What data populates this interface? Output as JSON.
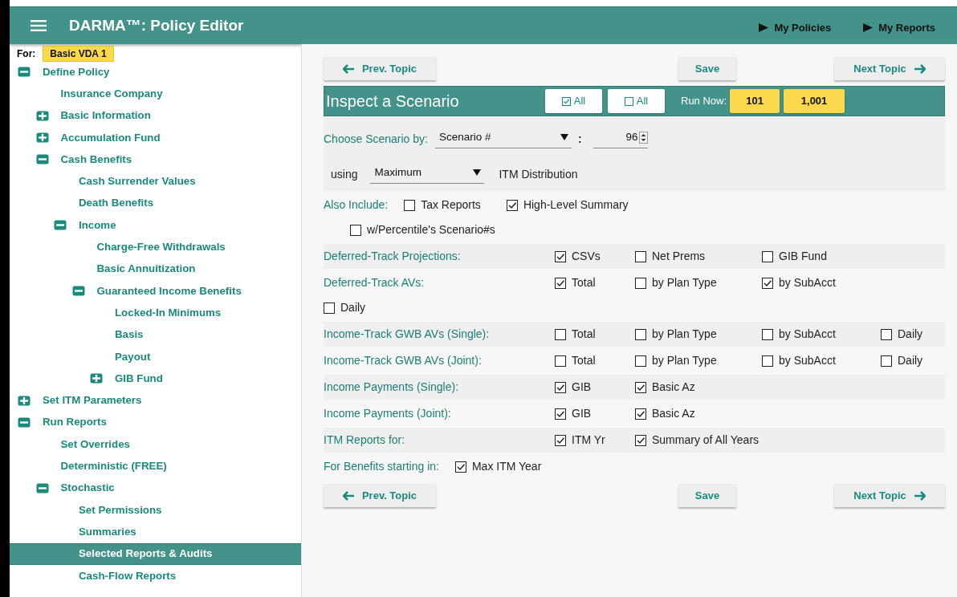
{
  "header": {
    "title": "DARMA™: Policy Editor",
    "links": [
      {
        "label": "My Policies"
      },
      {
        "label": "My Reports"
      }
    ]
  },
  "sidebar": {
    "for_label": "For:",
    "policy": "Basic VDA 1",
    "items": [
      {
        "label": "Define Policy",
        "expanded": true,
        "selected": false,
        "children": [
          {
            "label": "Insurance Company",
            "selected": false
          },
          {
            "label": "Basic Information",
            "expanded": false,
            "selected": false
          },
          {
            "label": "Accumulation Fund",
            "expanded": false,
            "selected": false
          },
          {
            "label": "Cash Benefits",
            "expanded": true,
            "selected": false,
            "children": [
              {
                "label": "Cash Surrender Values",
                "selected": false
              },
              {
                "label": "Death Benefits",
                "selected": false
              },
              {
                "label": "Income",
                "expanded": true,
                "selected": false,
                "children": [
                  {
                    "label": "Charge-Free Withdrawals",
                    "selected": false
                  },
                  {
                    "label": "Basic Annuitization",
                    "selected": false
                  },
                  {
                    "label": "Guaranteed Income Benefits",
                    "expanded": true,
                    "selected": false,
                    "children": [
                      {
                        "label": "Locked-In Minimums",
                        "selected": false
                      },
                      {
                        "label": "Basis",
                        "selected": false
                      },
                      {
                        "label": "Payout",
                        "selected": false
                      },
                      {
                        "label": "GIB Fund",
                        "expanded": false,
                        "selected": false
                      }
                    ]
                  }
                ]
              }
            ]
          }
        ]
      },
      {
        "label": "Set ITM Parameters",
        "expanded": false,
        "selected": false
      },
      {
        "label": "Run Reports",
        "expanded": true,
        "selected": false,
        "children": [
          {
            "label": "Set Overrides",
            "selected": false
          },
          {
            "label": "Deterministic (FREE)",
            "selected": false
          },
          {
            "label": "Stochastic",
            "expanded": true,
            "selected": false,
            "children": [
              {
                "label": "Set Permissions",
                "selected": false
              },
              {
                "label": "Summaries",
                "selected": false
              },
              {
                "label": "Selected Reports & Audits",
                "selected": true
              },
              {
                "label": "Cash-Flow Reports",
                "selected": false
              }
            ]
          }
        ]
      }
    ]
  },
  "nav_top": {
    "prev": "Prev. Topic",
    "save": "Save",
    "next": "Next Topic"
  },
  "panel": {
    "title": "Inspect a Scenario",
    "check_all": "All",
    "uncheck_all": "All",
    "run_label": "Run Now:",
    "run_buttons": [
      "101",
      "1,001"
    ]
  },
  "choose": {
    "label": "Choose Scenario by:",
    "select": "Scenario #",
    "separator": ":",
    "number": "96",
    "using": "using",
    "distribution": "Maximum",
    "distribution_label": "ITM Distribution"
  },
  "rows": [
    {
      "kind": "inline",
      "label": "Also Include:",
      "options": [
        {
          "label": "Tax Reports",
          "checked": false
        },
        {
          "label": "High-Level Summary",
          "checked": true
        }
      ],
      "second_line": [
        {
          "label": "w/Percentile's Scenario#s",
          "checked": false
        }
      ]
    },
    {
      "kind": "grid",
      "label": "Deferred-Track Projections:",
      "options": [
        {
          "label": "CSVs",
          "checked": true
        },
        {
          "label": "Net Prems",
          "checked": false
        },
        {
          "label": "GIB Fund",
          "checked": false
        }
      ]
    },
    {
      "kind": "grid",
      "label": "Deferred-Track AVs:",
      "options": [
        {
          "label": "Total",
          "checked": true
        },
        {
          "label": "by Plan Type",
          "checked": false
        },
        {
          "label": "by SubAcct",
          "checked": true
        }
      ],
      "second_line": [
        {
          "label": "Daily",
          "checked": false
        }
      ]
    },
    {
      "kind": "grid",
      "label": "Income-Track GWB AVs (Single):",
      "options": [
        {
          "label": "Total",
          "checked": false
        },
        {
          "label": "by Plan Type",
          "checked": false
        },
        {
          "label": "by SubAcct",
          "checked": false
        },
        {
          "label": "Daily",
          "checked": false
        }
      ]
    },
    {
      "kind": "grid",
      "label": "Income-Track GWB AVs (Joint):",
      "options": [
        {
          "label": "Total",
          "checked": false
        },
        {
          "label": "by Plan Type",
          "checked": false
        },
        {
          "label": "by SubAcct",
          "checked": false
        },
        {
          "label": "Daily",
          "checked": false
        }
      ]
    },
    {
      "kind": "grid",
      "label": "Income Payments (Single):",
      "options": [
        {
          "label": "GIB",
          "checked": true
        },
        {
          "label": "Basic Az",
          "checked": true
        }
      ]
    },
    {
      "kind": "grid",
      "label": "Income Payments (Joint):",
      "options": [
        {
          "label": "GIB",
          "checked": true
        },
        {
          "label": "Basic Az",
          "checked": true
        }
      ]
    },
    {
      "kind": "grid",
      "label": "ITM Reports for:",
      "options": [
        {
          "label": "ITM Yr",
          "checked": true
        },
        {
          "label": "Summary of All Years",
          "checked": true
        }
      ]
    },
    {
      "kind": "inline",
      "label": "For Benefits starting in:",
      "options": [
        {
          "label": "Max ITM Year",
          "checked": true
        }
      ]
    }
  ],
  "nav_bottom": {
    "prev": "Prev. Topic",
    "save": "Save",
    "next": "Next Topic"
  }
}
